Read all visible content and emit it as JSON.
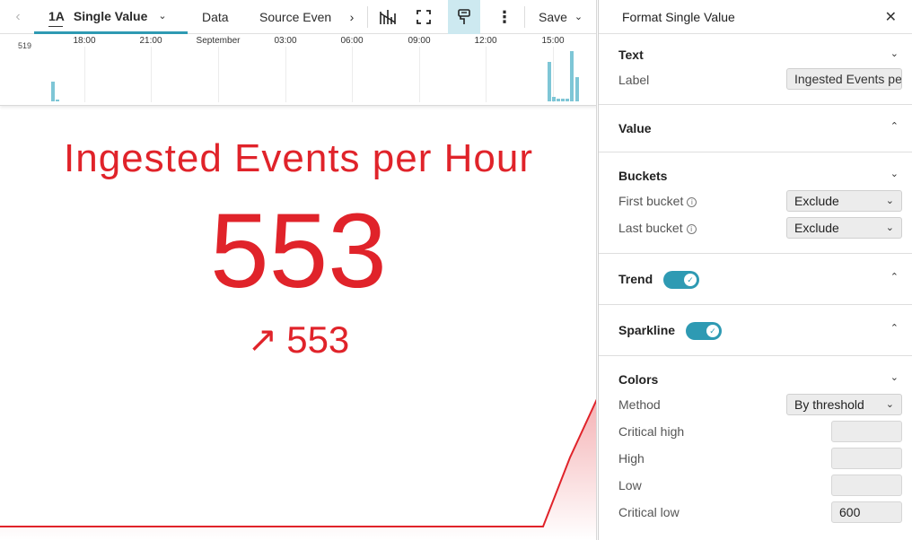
{
  "toolbar": {
    "back_icon": "chevron-left-icon",
    "viz_icon_text": "1A",
    "viz_label": "Single Value",
    "data_label": "Data",
    "source_label": "Source Even",
    "more_icon": "chevron-right-icon",
    "save_label": "Save"
  },
  "histogram": {
    "ymax_label": "519",
    "ticks": [
      "18:00",
      "21:00",
      "September",
      "03:00",
      "06:00",
      "09:00",
      "12:00",
      "15:00"
    ],
    "bar_color": "#7ec6d6"
  },
  "single_value": {
    "title": "Ingested Events per Hour",
    "value": "553",
    "trend_value": "553",
    "color": "#e0232a"
  },
  "chart_data": {
    "type": "area",
    "series": [
      {
        "values": [
          0,
          0,
          0,
          0,
          0,
          0,
          0,
          0,
          0,
          0,
          0,
          0,
          0,
          0,
          0,
          0,
          0,
          0,
          0,
          0,
          0,
          0,
          0,
          0,
          0,
          300,
          553
        ]
      }
    ],
    "color": "#e0232a"
  },
  "panel": {
    "title": "Format Single Value",
    "close_icon": "close-icon",
    "text_section": {
      "title": "Text",
      "label_label": "Label",
      "label_value": "Ingested Events per Hour"
    },
    "value_section": {
      "title": "Value"
    },
    "buckets_section": {
      "title": "Buckets",
      "first_label": "First bucket",
      "first_value": "Exclude",
      "last_label": "Last bucket",
      "last_value": "Exclude"
    },
    "trend_section": {
      "title": "Trend",
      "enabled": true
    },
    "sparkline_section": {
      "title": "Sparkline",
      "enabled": true
    },
    "colors_section": {
      "title": "Colors",
      "method_label": "Method",
      "method_value": "By threshold",
      "critical_high_label": "Critical high",
      "critical_high_value": "",
      "high_label": "High",
      "high_value": "",
      "low_label": "Low",
      "low_value": "",
      "critical_low_label": "Critical low",
      "critical_low_value": "600"
    }
  }
}
